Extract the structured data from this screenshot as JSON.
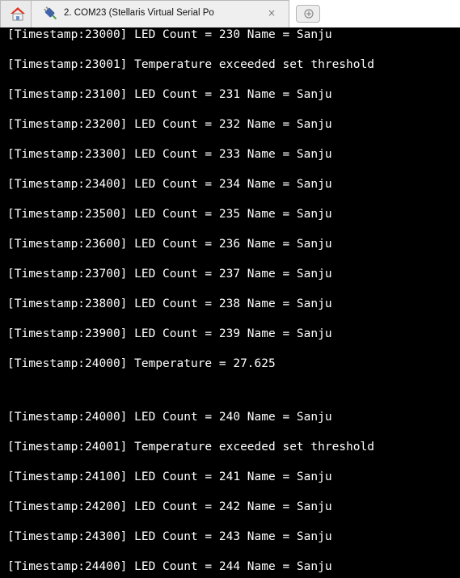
{
  "tab": {
    "title": "2. COM23  (Stellaris Virtual Serial Po",
    "close_glyph": "×",
    "home_icon": "home-icon",
    "plug_icon": "serial-port-icon",
    "new_tab_icon": "new-tab-icon"
  },
  "colors": {
    "terminal_bg": "#000000",
    "terminal_fg": "#ffffff",
    "tabbar_bg": "#ffffff",
    "home_roof": "#e0301e"
  },
  "terminal": {
    "lines": [
      "[Timestamp:23000] LED Count = 230 Name = Sanju",
      "[Timestamp:23001] Temperature exceeded set threshold",
      "[Timestamp:23100] LED Count = 231 Name = Sanju",
      "[Timestamp:23200] LED Count = 232 Name = Sanju",
      "[Timestamp:23300] LED Count = 233 Name = Sanju",
      "[Timestamp:23400] LED Count = 234 Name = Sanju",
      "[Timestamp:23500] LED Count = 235 Name = Sanju",
      "[Timestamp:23600] LED Count = 236 Name = Sanju",
      "[Timestamp:23700] LED Count = 237 Name = Sanju",
      "[Timestamp:23800] LED Count = 238 Name = Sanju",
      "[Timestamp:23900] LED Count = 239 Name = Sanju",
      "[Timestamp:24000] Temperature = 27.625",
      "",
      "[Timestamp:24000] LED Count = 240 Name = Sanju",
      "[Timestamp:24001] Temperature exceeded set threshold",
      "[Timestamp:24100] LED Count = 241 Name = Sanju",
      "[Timestamp:24200] LED Count = 242 Name = Sanju",
      "[Timestamp:24300] LED Count = 243 Name = Sanju",
      "[Timestamp:24400] LED Count = 244 Name = Sanju"
    ]
  }
}
